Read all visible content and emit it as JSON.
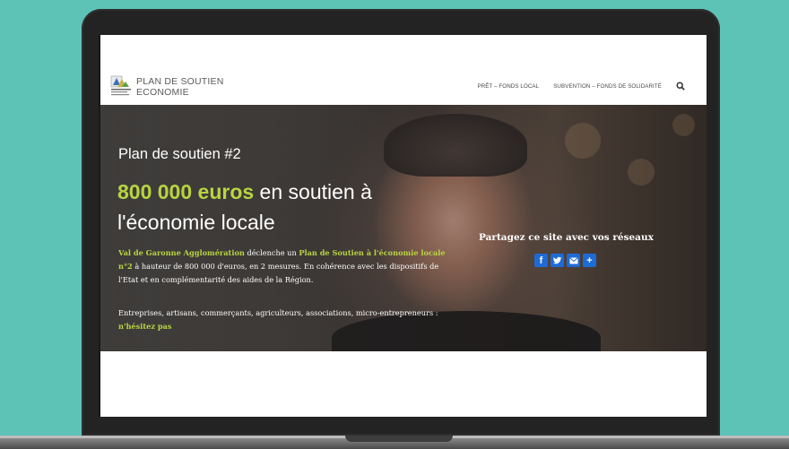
{
  "header": {
    "title_line1": "PLAN DE SOUTIEN",
    "title_line2": "ECONOMIE",
    "nav": [
      {
        "label": "PRÊT – FONDS LOCAL"
      },
      {
        "label": "SUBVENTION – FONDS DE SOLIDARITÉ"
      }
    ]
  },
  "hero": {
    "subtitle": "Plan de soutien #2",
    "amount": "800 000 euros",
    "headline_rest_1": " en soutien à",
    "headline_rest_2": "l'économie locale",
    "p1_org": "Val de Garonne Agglomération",
    "p1_text1": " déclenche un ",
    "p1_plan": "Plan de Soutien à l'économie locale n°2",
    "p1_text2": " à hauteur de 800 000 d'euros, en 2 mesures. En cohérence avec les dispositifs de l'Etat et en complémentarité des aides de la Région.",
    "p2_text": "Entreprises, artisans, commerçants, agriculteurs, associations, micro-entrepreneurs : ",
    "p2_cta": "n'hésitez pas"
  },
  "share": {
    "title": "Partagez ce site avec vos réseaux",
    "buttons": [
      {
        "icon": "facebook-icon",
        "glyph": "f"
      },
      {
        "icon": "twitter-icon",
        "glyph": "t"
      },
      {
        "icon": "email-icon",
        "glyph": "✉"
      },
      {
        "icon": "plus-icon",
        "glyph": "+"
      }
    ]
  },
  "colors": {
    "background": "#5cc3b6",
    "accent": "#b8d441",
    "share_blue": "#1e6bd6"
  }
}
